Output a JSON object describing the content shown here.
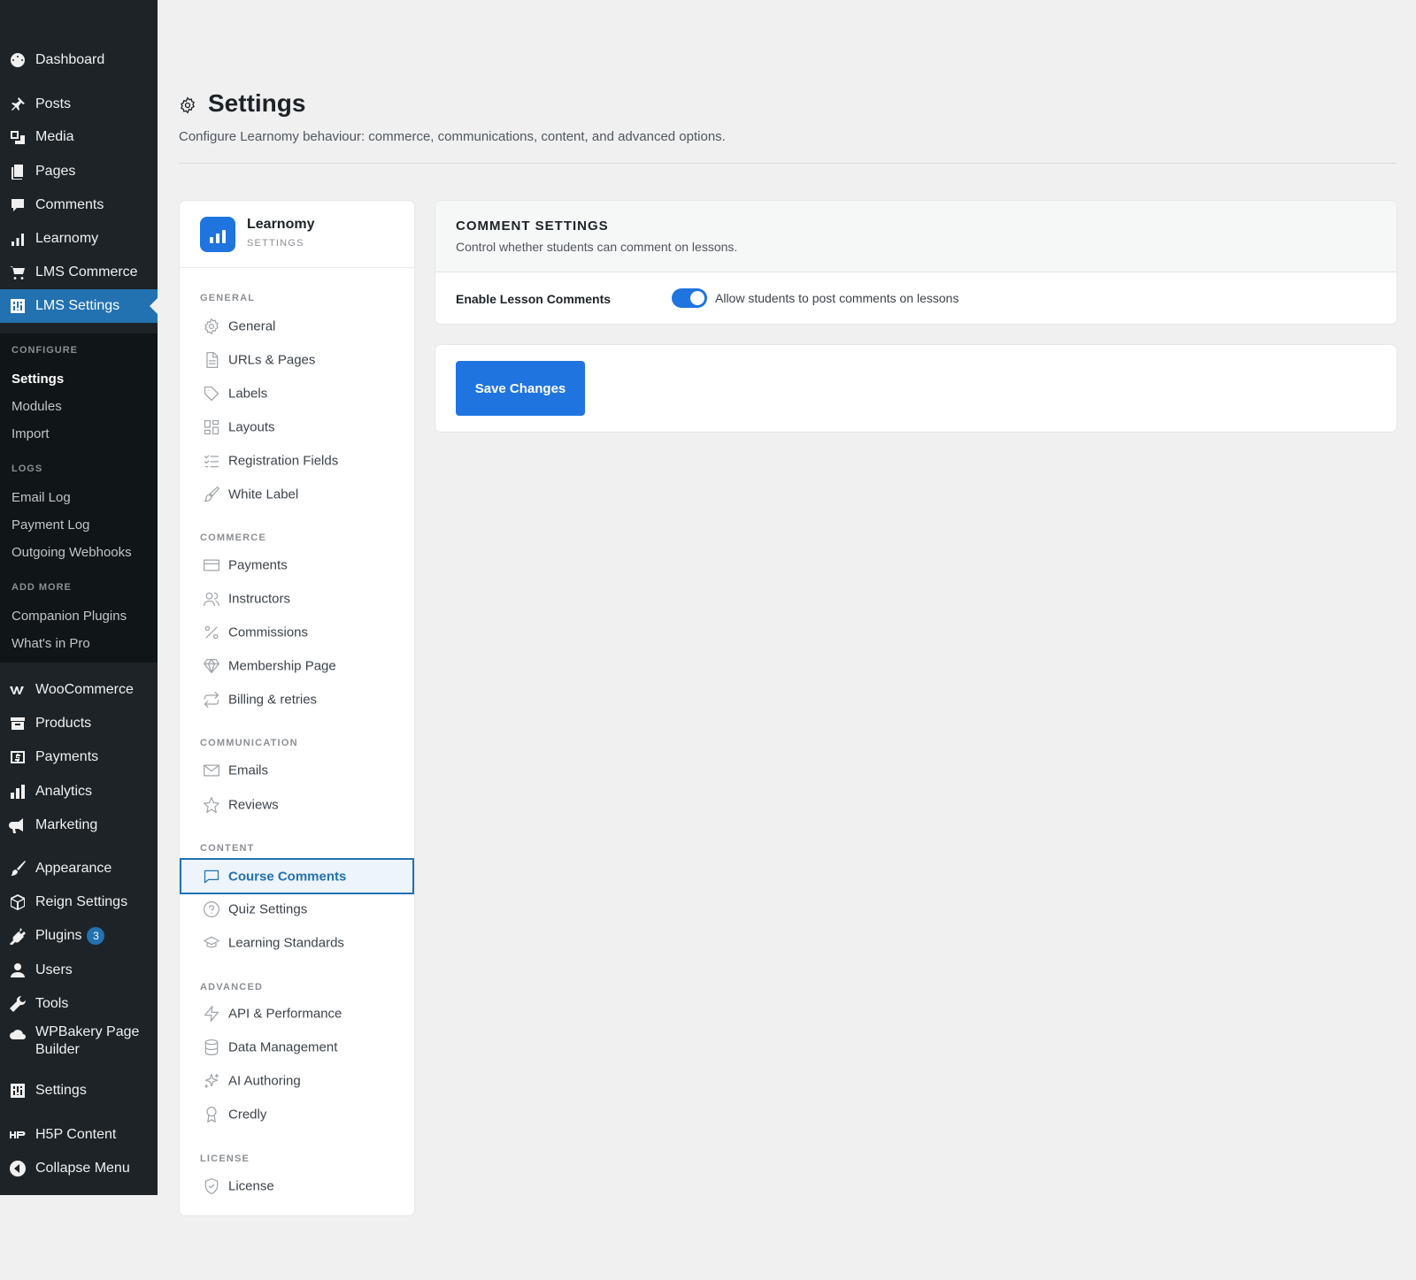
{
  "admin_menu": {
    "dashboard": "Dashboard",
    "posts": "Posts",
    "media": "Media",
    "pages": "Pages",
    "comments": "Comments",
    "learnomy": "Learnomy",
    "lms_commerce": "LMS Commerce",
    "lms_settings": "LMS Settings",
    "woocommerce": "WooCommerce",
    "products": "Products",
    "payments": "Payments",
    "analytics": "Analytics",
    "marketing": "Marketing",
    "appearance": "Appearance",
    "reign_settings": "Reign Settings",
    "plugins": "Plugins",
    "plugins_badge": "3",
    "users": "Users",
    "tools": "Tools",
    "wpbakery_line1": "WPBakery Page",
    "wpbakery_line2": "Builder",
    "settings": "Settings",
    "h5p": "H5P Content",
    "collapse": "Collapse Menu"
  },
  "submenu": {
    "configure_head": "CONFIGURE",
    "settings": "Settings",
    "modules": "Modules",
    "import": "Import",
    "logs_head": "LOGS",
    "email_log": "Email Log",
    "payment_log": "Payment Log",
    "outgoing_webhooks": "Outgoing Webhooks",
    "add_more_head": "ADD MORE",
    "companion_plugins": "Companion Plugins",
    "whats_in_pro": "What's in Pro"
  },
  "header": {
    "title": "Settings",
    "description": "Configure Learnomy behaviour: commerce, communications, content, and advanced options."
  },
  "settings_nav": {
    "brand_name": "Learnomy",
    "brand_sub": "SETTINGS",
    "general_head": "GENERAL",
    "general": "General",
    "urls_pages": "URLs & Pages",
    "labels": "Labels",
    "layouts": "Layouts",
    "registration_fields": "Registration Fields",
    "white_label": "White Label",
    "commerce_head": "COMMERCE",
    "payments": "Payments",
    "instructors": "Instructors",
    "commissions": "Commissions",
    "membership_page": "Membership Page",
    "billing_retries": "Billing & retries",
    "communication_head": "COMMUNICATION",
    "emails": "Emails",
    "reviews": "Reviews",
    "content_head": "CONTENT",
    "course_comments": "Course Comments",
    "quiz_settings": "Quiz Settings",
    "learning_standards": "Learning Standards",
    "advanced_head": "ADVANCED",
    "api_performance": "API & Performance",
    "data_management": "Data Management",
    "ai_authoring": "AI Authoring",
    "credly": "Credly",
    "license_head": "LICENSE",
    "license": "License"
  },
  "comment_settings": {
    "title": "COMMENT SETTINGS",
    "description": "Control whether students can comment on lessons.",
    "field_label": "Enable Lesson Comments",
    "toggle_on": true,
    "toggle_description": "Allow students to post comments on lessons"
  },
  "actions": {
    "save_label": "Save Changes"
  },
  "colors": {
    "accent": "#1f74e0",
    "wp_menu_bg": "#1d2327",
    "wp_current": "#2271b1"
  }
}
